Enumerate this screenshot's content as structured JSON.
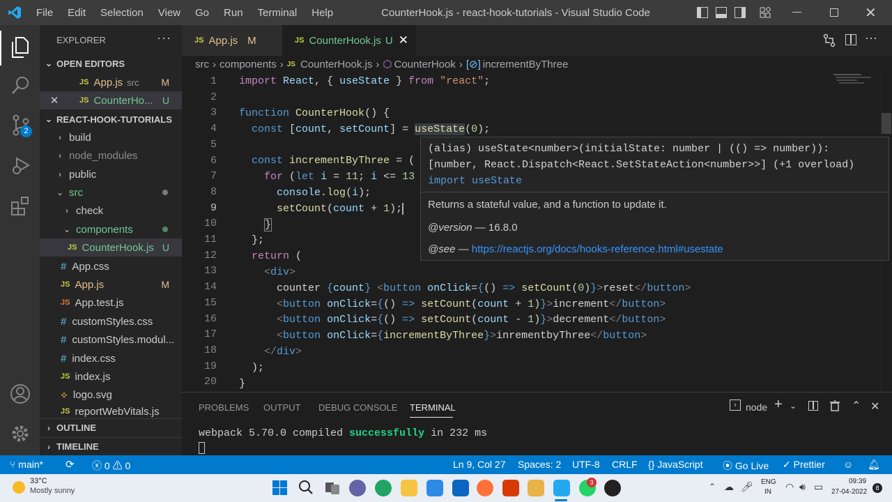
{
  "window": {
    "title": "CounterHook.js - react-hook-tutorials - Visual Studio Code"
  },
  "menu": [
    "File",
    "Edit",
    "Selection",
    "View",
    "Go",
    "Run",
    "Terminal",
    "Help"
  ],
  "activity": {
    "scm_badge": "2"
  },
  "sidebar": {
    "header": "EXPLORER",
    "open_editors_label": "OPEN EDITORS",
    "open_editors": [
      {
        "icon": "JS",
        "name": "App.js",
        "desc": "src",
        "status": "M"
      },
      {
        "icon": "JS",
        "name": "CounterHo...",
        "status": "U"
      }
    ],
    "project_label": "REACT-HOOK-TUTORIALS",
    "tree": [
      {
        "name": "build",
        "type": "folder"
      },
      {
        "name": "node_modules",
        "type": "folder"
      },
      {
        "name": "public",
        "type": "folder"
      },
      {
        "name": "src",
        "type": "folder-open"
      },
      {
        "name": "check",
        "type": "folder"
      },
      {
        "name": "components",
        "type": "folder-open"
      },
      {
        "name": "CounterHook.js",
        "type": "js",
        "status": "U"
      },
      {
        "name": "App.css",
        "type": "css"
      },
      {
        "name": "App.js",
        "type": "js",
        "status": "M"
      },
      {
        "name": "App.test.js",
        "type": "js"
      },
      {
        "name": "customStyles.css",
        "type": "css"
      },
      {
        "name": "customStyles.modul...",
        "type": "css"
      },
      {
        "name": "index.css",
        "type": "css"
      },
      {
        "name": "index.js",
        "type": "js"
      },
      {
        "name": "logo.svg",
        "type": "svg"
      },
      {
        "name": "reportWebVitals.js",
        "type": "js"
      }
    ],
    "outline_label": "OUTLINE",
    "timeline_label": "TIMELINE"
  },
  "tabs": [
    {
      "icon": "JS",
      "label": "App.js",
      "status": "M"
    },
    {
      "icon": "JS",
      "label": "CounterHook.js",
      "status": "U"
    }
  ],
  "breadcrumb": [
    "src",
    "components",
    "CounterHook.js",
    "CounterHook",
    "incrementByThree"
  ],
  "line_numbers": [
    "1",
    "2",
    "3",
    "4",
    "5",
    "6",
    "7",
    "8",
    "9",
    "10",
    "11",
    "12",
    "13",
    "14",
    "15",
    "16",
    "17",
    "18",
    "19",
    "20"
  ],
  "hover": {
    "sig1": "(alias) useState<number>(initialState: number | (() => number)):",
    "sig2": "[number, React.Dispatch<React.SetStateAction<number>>] (+1 overload)",
    "sig3": "import useState",
    "doc": "Returns a stateful value, and a function to update it.",
    "version_tag": "@version",
    "version": "— 16.8.0",
    "see_tag": "@see",
    "see_dash": "—",
    "link": "https://reactjs.org/docs/hooks-reference.html#usestate"
  },
  "panel": {
    "tabs": [
      "PROBLEMS",
      "OUTPUT",
      "DEBUG CONSOLE",
      "TERMINAL"
    ],
    "shell": "node",
    "terminal_pre": "webpack 5.70.0 compiled ",
    "terminal_ok": "successfully",
    "terminal_post": " in 232 ms"
  },
  "status": {
    "branch": "main*",
    "errors": "0",
    "warnings": "0",
    "position": "Ln 9, Col 27",
    "spaces": "Spaces: 2",
    "encoding": "UTF-8",
    "eol": "CRLF",
    "language": "JavaScript",
    "golive": "Go Live",
    "prettier": "Prettier"
  },
  "taskbar": {
    "temp": "33°C",
    "weather": "Mostly sunny",
    "lang1": "ENG",
    "lang2": "IN",
    "time": "09:39",
    "date": "27-04-2022",
    "notif": "8",
    "badge": "3"
  },
  "colors": {
    "accent": "#007acc",
    "modified": "#e2c08d",
    "untracked": "#73c991",
    "link": "#3794ff"
  }
}
